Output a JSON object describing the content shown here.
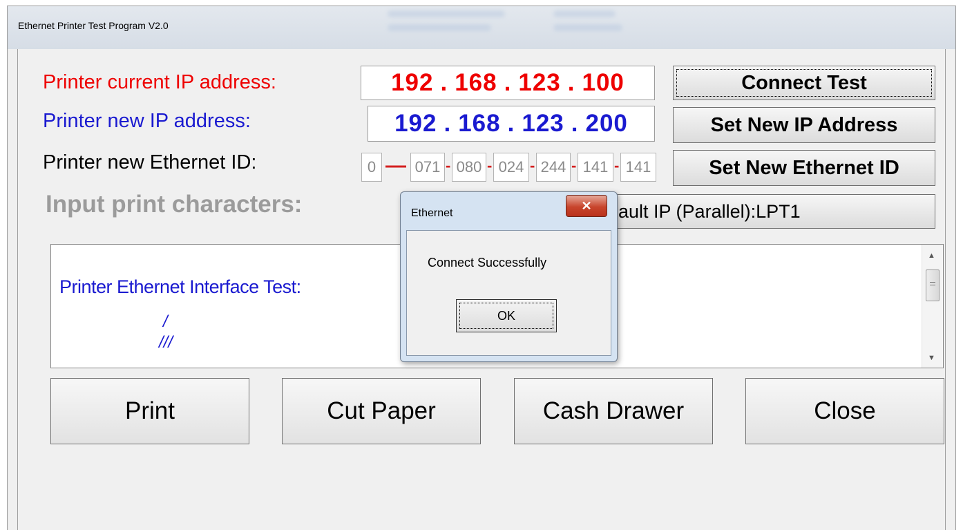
{
  "window": {
    "title": "Ethernet  Printer Test Program  V2.0"
  },
  "labels": {
    "current_ip": "Printer current IP address:",
    "new_ip": "Printer new IP address:",
    "new_eid": "Printer new Ethernet ID:",
    "input_chars": "Input print characters:"
  },
  "current_ip": {
    "o1": "192",
    "o2": "168",
    "o3": "123",
    "o4": "100"
  },
  "new_ip": {
    "o1": "192",
    "o2": "168",
    "o3": "123",
    "o4": "200"
  },
  "ethernet_id": {
    "prefix": "0",
    "parts": [
      "071",
      "080",
      "024",
      "244",
      "141"
    ]
  },
  "buttons": {
    "connect_test": "Connect Test",
    "set_ip": "Set New IP Address",
    "set_eid": "Set New Ethernet ID",
    "port_select": "ault IP (Parallel):LPT1",
    "print": "Print",
    "cut_paper": "Cut Paper",
    "cash_drawer": "Cash Drawer",
    "close": "Close"
  },
  "textarea": {
    "line1": "Printer Ethernet Interface Test:",
    "line2": "/",
    "line3": "///"
  },
  "dialog": {
    "title": "Ethernet",
    "close_glyph": "✕",
    "message": "Connect Successfully",
    "ok": "OK"
  },
  "colors": {
    "current_ip": "#ee0000",
    "new_ip": "#1a1ad0",
    "input_label": "#9b9b9b"
  }
}
